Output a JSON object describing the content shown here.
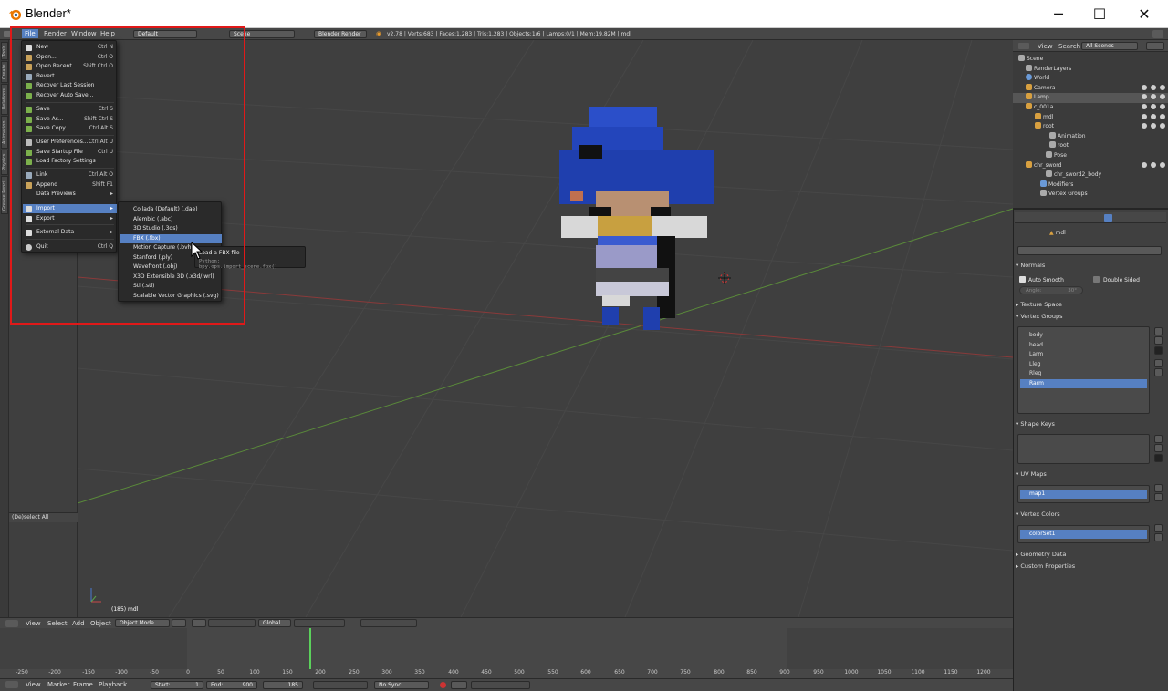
{
  "window": {
    "title": "Blender*",
    "minimize": "─",
    "maximize": "☐",
    "close": "✕"
  },
  "infobar": {
    "menus": [
      "File",
      "Render",
      "Window",
      "Help"
    ],
    "layout": "Default",
    "scene": "Scene",
    "engine": "Blender Render",
    "stats": "v2.78 | Verts:683 | Faces:1,283 | Tris:1,283 | Objects:1/6 | Lamps:0/1 | Mem:19.82M | mdl"
  },
  "tool_tabs": [
    "Tools",
    "Create",
    "Relations",
    "Animation",
    "Physics",
    "Grease Pencil"
  ],
  "toolshelf": {
    "operator": "(De)select All"
  },
  "viewport": {
    "object_label": "(185) mdl"
  },
  "file_menu": {
    "items": [
      {
        "label": "New",
        "shortcut": "Ctrl N",
        "icon": "new-file-icon"
      },
      {
        "label": "Open...",
        "shortcut": "Ctrl O",
        "icon": "folder-icon"
      },
      {
        "label": "Open Recent...",
        "shortcut": "Shift Ctrl O",
        "icon": "recent-icon"
      },
      {
        "label": "Revert",
        "shortcut": "",
        "icon": "revert-icon"
      },
      {
        "label": "Recover Last Session",
        "shortcut": "",
        "icon": "recover-icon"
      },
      {
        "label": "Recover Auto Save...",
        "shortcut": "",
        "icon": "recover-icon"
      },
      {
        "label": "Save",
        "shortcut": "Ctrl S",
        "icon": "check-icon"
      },
      {
        "label": "Save As...",
        "shortcut": "Shift Ctrl S",
        "icon": "save-as-icon"
      },
      {
        "label": "Save Copy...",
        "shortcut": "Ctrl Alt S",
        "icon": "save-copy-icon"
      },
      {
        "label": "User Preferences...",
        "shortcut": "Ctrl Alt U",
        "icon": "preferences-icon"
      },
      {
        "label": "Save Startup File",
        "shortcut": "Ctrl U",
        "icon": "save-startup-icon"
      },
      {
        "label": "Load Factory Settings",
        "shortcut": "",
        "icon": "factory-icon"
      },
      {
        "label": "Link",
        "shortcut": "Ctrl Alt O",
        "icon": "link-icon"
      },
      {
        "label": "Append",
        "shortcut": "Shift F1",
        "icon": "append-icon"
      },
      {
        "label": "Data Previews",
        "shortcut": "▸",
        "icon": ""
      },
      {
        "label": "Import",
        "shortcut": "▸",
        "icon": "import-icon"
      },
      {
        "label": "Export",
        "shortcut": "▸",
        "icon": "export-icon"
      },
      {
        "label": "External Data",
        "shortcut": "▸",
        "icon": "external-data-icon"
      },
      {
        "label": "Quit",
        "shortcut": "Ctrl Q",
        "icon": "quit-icon"
      }
    ]
  },
  "import_menu": {
    "items": [
      "Collada (Default) (.dae)",
      "Alembic (.abc)",
      "3D Studio (.3ds)",
      "FBX (.fbx)",
      "Motion Capture (.bvh)",
      "Stanford (.ply)",
      "Wavefront (.obj)",
      "X3D Extensible 3D (.x3d/.wrl)",
      "Stl (.stl)",
      "Scalable Vector Graphics (.svg)"
    ]
  },
  "tooltip": {
    "title": "Load a FBX file",
    "python": "Python: bpy.ops.import_scene.fbx()"
  },
  "outliner": {
    "menu_view": "View",
    "menu_search": "Search",
    "filter": "All Scenes",
    "rows": [
      "Scene",
      "RenderLayers",
      "World",
      "Camera",
      "Lamp",
      "c_001a",
      "mdl",
      "root",
      "Animation",
      "root",
      "Pose",
      "chr_sword",
      "chr_sword2_body",
      "Modifiers",
      "Vertex Groups"
    ]
  },
  "properties": {
    "object_name": "mdl",
    "normals": {
      "title": "Normals",
      "auto_smooth": "Auto Smooth",
      "double_sided": "Double Sided",
      "angle": "Angle:",
      "angle_value": "30°"
    },
    "texture_space": "Texture Space",
    "vertex_groups": {
      "title": "Vertex Groups",
      "items": [
        "body",
        "head",
        "Larm",
        "Lleg",
        "Rleg",
        "Rarm"
      ]
    },
    "shape_keys": "Shape Keys",
    "uv_maps": {
      "title": "UV Maps",
      "item": "map1"
    },
    "vertex_colors": {
      "title": "Vertex Colors",
      "item": "colorSet1"
    },
    "geometry_data": "Geometry Data",
    "custom_properties": "Custom Properties"
  },
  "view_header": {
    "view": "View",
    "select": "Select",
    "add": "Add",
    "object": "Object",
    "mode": "Object Mode",
    "orientation": "Global"
  },
  "timeline": {
    "ticks": [
      "-250",
      "-200",
      "-150",
      "-100",
      "-50",
      "0",
      "50",
      "100",
      "150",
      "200",
      "250",
      "300",
      "350",
      "400",
      "450",
      "500",
      "550",
      "600",
      "650",
      "700",
      "750",
      "800",
      "850",
      "900",
      "950",
      "1000",
      "1050",
      "1100",
      "1150",
      "1200"
    ],
    "view": "View",
    "marker": "Marker",
    "frame": "Frame",
    "playback": "Playback",
    "start_label": "Start:",
    "start": "1",
    "end_label": "End:",
    "end": "900",
    "current": "185",
    "sync": "No Sync"
  }
}
